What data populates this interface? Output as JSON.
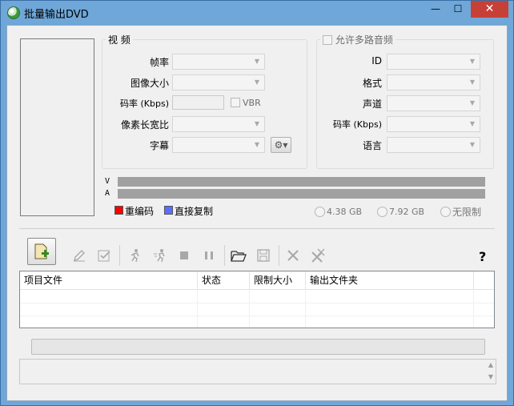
{
  "window": {
    "title": "批量输出DVD",
    "minimize_glyph": "—",
    "maximize_glyph": "☐",
    "close_glyph": "✕"
  },
  "video": {
    "legend": "视 频",
    "framerate_label": "帧率",
    "imagesize_label": "图像大小",
    "bitrate_label": "码率 (Kbps)",
    "vbr_label": "VBR",
    "aspect_label": "像素长宽比",
    "subtitle_label": "字幕"
  },
  "audio": {
    "multi_audio_label": "允许多路音频",
    "id_label": "ID",
    "format_label": "格式",
    "channel_label": "声道",
    "bitrate_label": "码率 (Kbps)",
    "language_label": "语言"
  },
  "bars": {
    "v_label": "V",
    "a_label": "A"
  },
  "legend": {
    "reencode_label": "重编码",
    "reencode_color": "#ff0000",
    "copy_label": "直接复制",
    "copy_color": "#5a6fff"
  },
  "size_options": {
    "opt1": "4.38 GB",
    "opt2": "7.92 GB",
    "opt3": "无限制"
  },
  "toolbar": {
    "add_icon": "add-file-icon",
    "edit_icon": "edit-icon",
    "check_icon": "check-icon",
    "run_icon": "run-icon",
    "run_all_icon": "run-all-icon",
    "stop_icon": "stop-icon",
    "pause_icon": "pause-icon",
    "open_icon": "open-folder-icon",
    "save_icon": "save-icon",
    "delete_icon": "delete-icon",
    "delete_all_icon": "delete-all-icon",
    "help_label": "?"
  },
  "table": {
    "columns": [
      "项目文件",
      "状态",
      "限制大小",
      "输出文件夹"
    ]
  },
  "colors": {
    "titlebar": "#6ea7d8",
    "close": "#c74037",
    "bar_fill": "#a0a0a0"
  }
}
